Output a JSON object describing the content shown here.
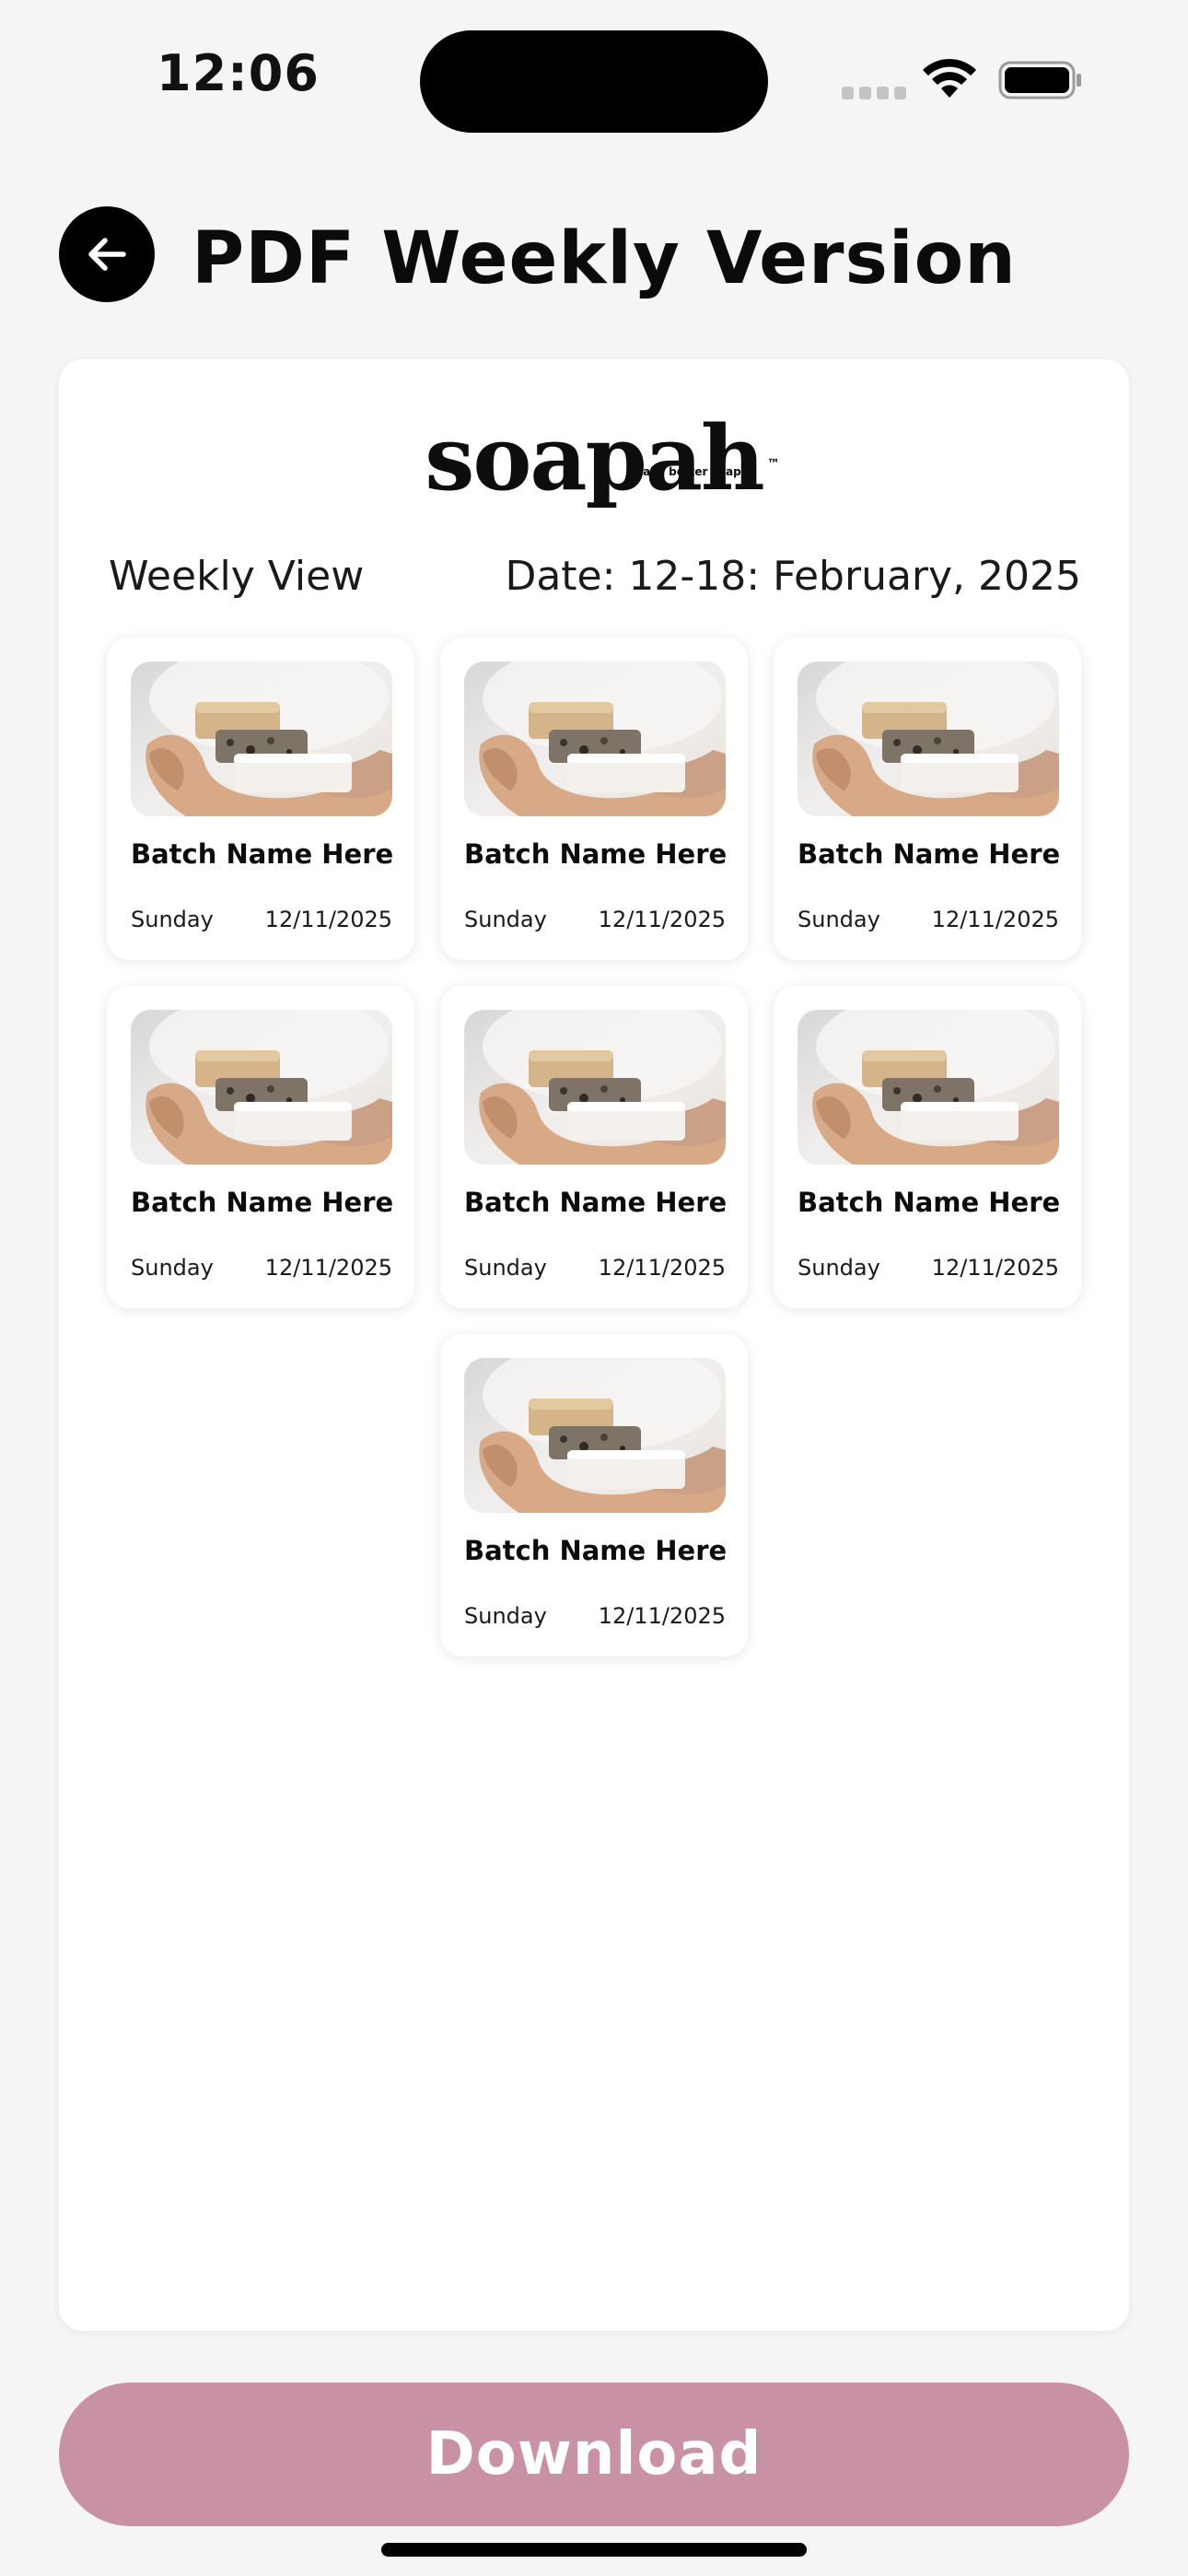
{
  "status_bar": {
    "time": "12:06"
  },
  "header": {
    "back_icon": "arrow-left-icon",
    "title": "PDF Weekly Version"
  },
  "document": {
    "brand": {
      "name": "soapah",
      "trademark": "™",
      "tagline": "make better soap"
    },
    "view_label": "Weekly View",
    "date_label": "Date: 12-18: February, 2025",
    "batches": [
      {
        "name": "Batch Name Here",
        "day": "Sunday",
        "date": "12/11/2025"
      },
      {
        "name": "Batch Name Here",
        "day": "Sunday",
        "date": "12/11/2025"
      },
      {
        "name": "Batch Name Here",
        "day": "Sunday",
        "date": "12/11/2025"
      },
      {
        "name": "Batch Name Here",
        "day": "Sunday",
        "date": "12/11/2025"
      },
      {
        "name": "Batch Name Here",
        "day": "Sunday",
        "date": "12/11/2025"
      },
      {
        "name": "Batch Name Here",
        "day": "Sunday",
        "date": "12/11/2025"
      },
      {
        "name": "Batch Name Here",
        "day": "Sunday",
        "date": "12/11/2025"
      }
    ]
  },
  "footer": {
    "download_label": "Download"
  },
  "colors": {
    "background": "#f6f5f6",
    "accent": "#c991a6",
    "card": "#ffffff",
    "text": "#111111"
  }
}
